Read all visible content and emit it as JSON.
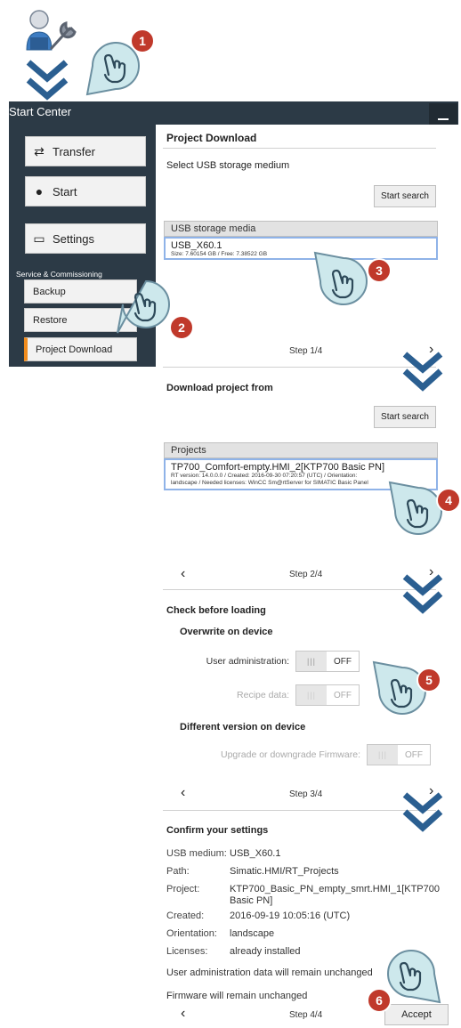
{
  "window": {
    "title": "Start Center"
  },
  "sidebar": {
    "transfer_label": "Transfer",
    "start_label": "Start",
    "settings_label": "Settings",
    "service_label": "Service & Commissioning",
    "sub_items": [
      {
        "label": "Backup"
      },
      {
        "label": "Restore"
      },
      {
        "label": "Project Download"
      }
    ]
  },
  "step1": {
    "title": "Project Download",
    "subtitle": "Select USB storage medium",
    "search_label": "Start search",
    "list_header": "USB storage media",
    "item_name": "USB_X60.1",
    "item_detail": "Size: 7.60154 GB / Free: 7.38522 GB",
    "step_text": "Step 1/4"
  },
  "step2": {
    "title": "Download project from",
    "search_label": "Start search",
    "list_header": "Projects",
    "item_name": "TP700_Comfort-empty.HMI_2[KTP700 Basic PN]",
    "item_detail_1": "RT version: 14.0.0.0 / Created: 2016-09-30 07:20:57 (UTC) / Orientation:",
    "item_detail_2": "landscape / Needed licenses: WinCC Sm@rtServer for SIMATIC Basic Panel",
    "step_text": "Step 2/4"
  },
  "step3": {
    "title": "Check before loading",
    "section1": "Overwrite on device",
    "user_admin_label": "User administration:",
    "user_admin_state": "OFF",
    "recipe_label": "Recipe data:",
    "recipe_state": "OFF",
    "section2": "Different version on device",
    "firmware_label": "Upgrade or downgrade Firmware:",
    "firmware_state": "OFF",
    "step_text": "Step 3/4"
  },
  "step4": {
    "title": "Confirm your settings",
    "rows": [
      {
        "label": "USB medium:",
        "value": "USB_X60.1"
      },
      {
        "label": "Path:",
        "value": "Simatic.HMI/RT_Projects"
      },
      {
        "label": "Project:",
        "value": "KTP700_Basic_PN_empty_smrt.HMI_1[KTP700",
        "value2": "Basic PN]"
      },
      {
        "label": "Created:",
        "value": "2016-09-19 10:05:16 (UTC)"
      },
      {
        "label": "Orientation:",
        "value": "landscape"
      },
      {
        "label": "Licenses:",
        "value": "already installed"
      }
    ],
    "note1": "User administration data will remain unchanged",
    "note2": "Firmware will remain unchanged",
    "step_text": "Step 4/4",
    "accept_label": "Accept"
  },
  "nav": {
    "prev": "‹",
    "next": "›"
  },
  "badges": [
    "1",
    "2",
    "3",
    "4",
    "5",
    "6"
  ],
  "colors": {
    "panel": "#2c3a46",
    "accent_orange": "#f08c1e",
    "selection_blue": "#8fb3e8",
    "badge_red": "#c0392b",
    "chevron_blue": "#2b5f91",
    "hand_fill": "#cde8ec"
  }
}
